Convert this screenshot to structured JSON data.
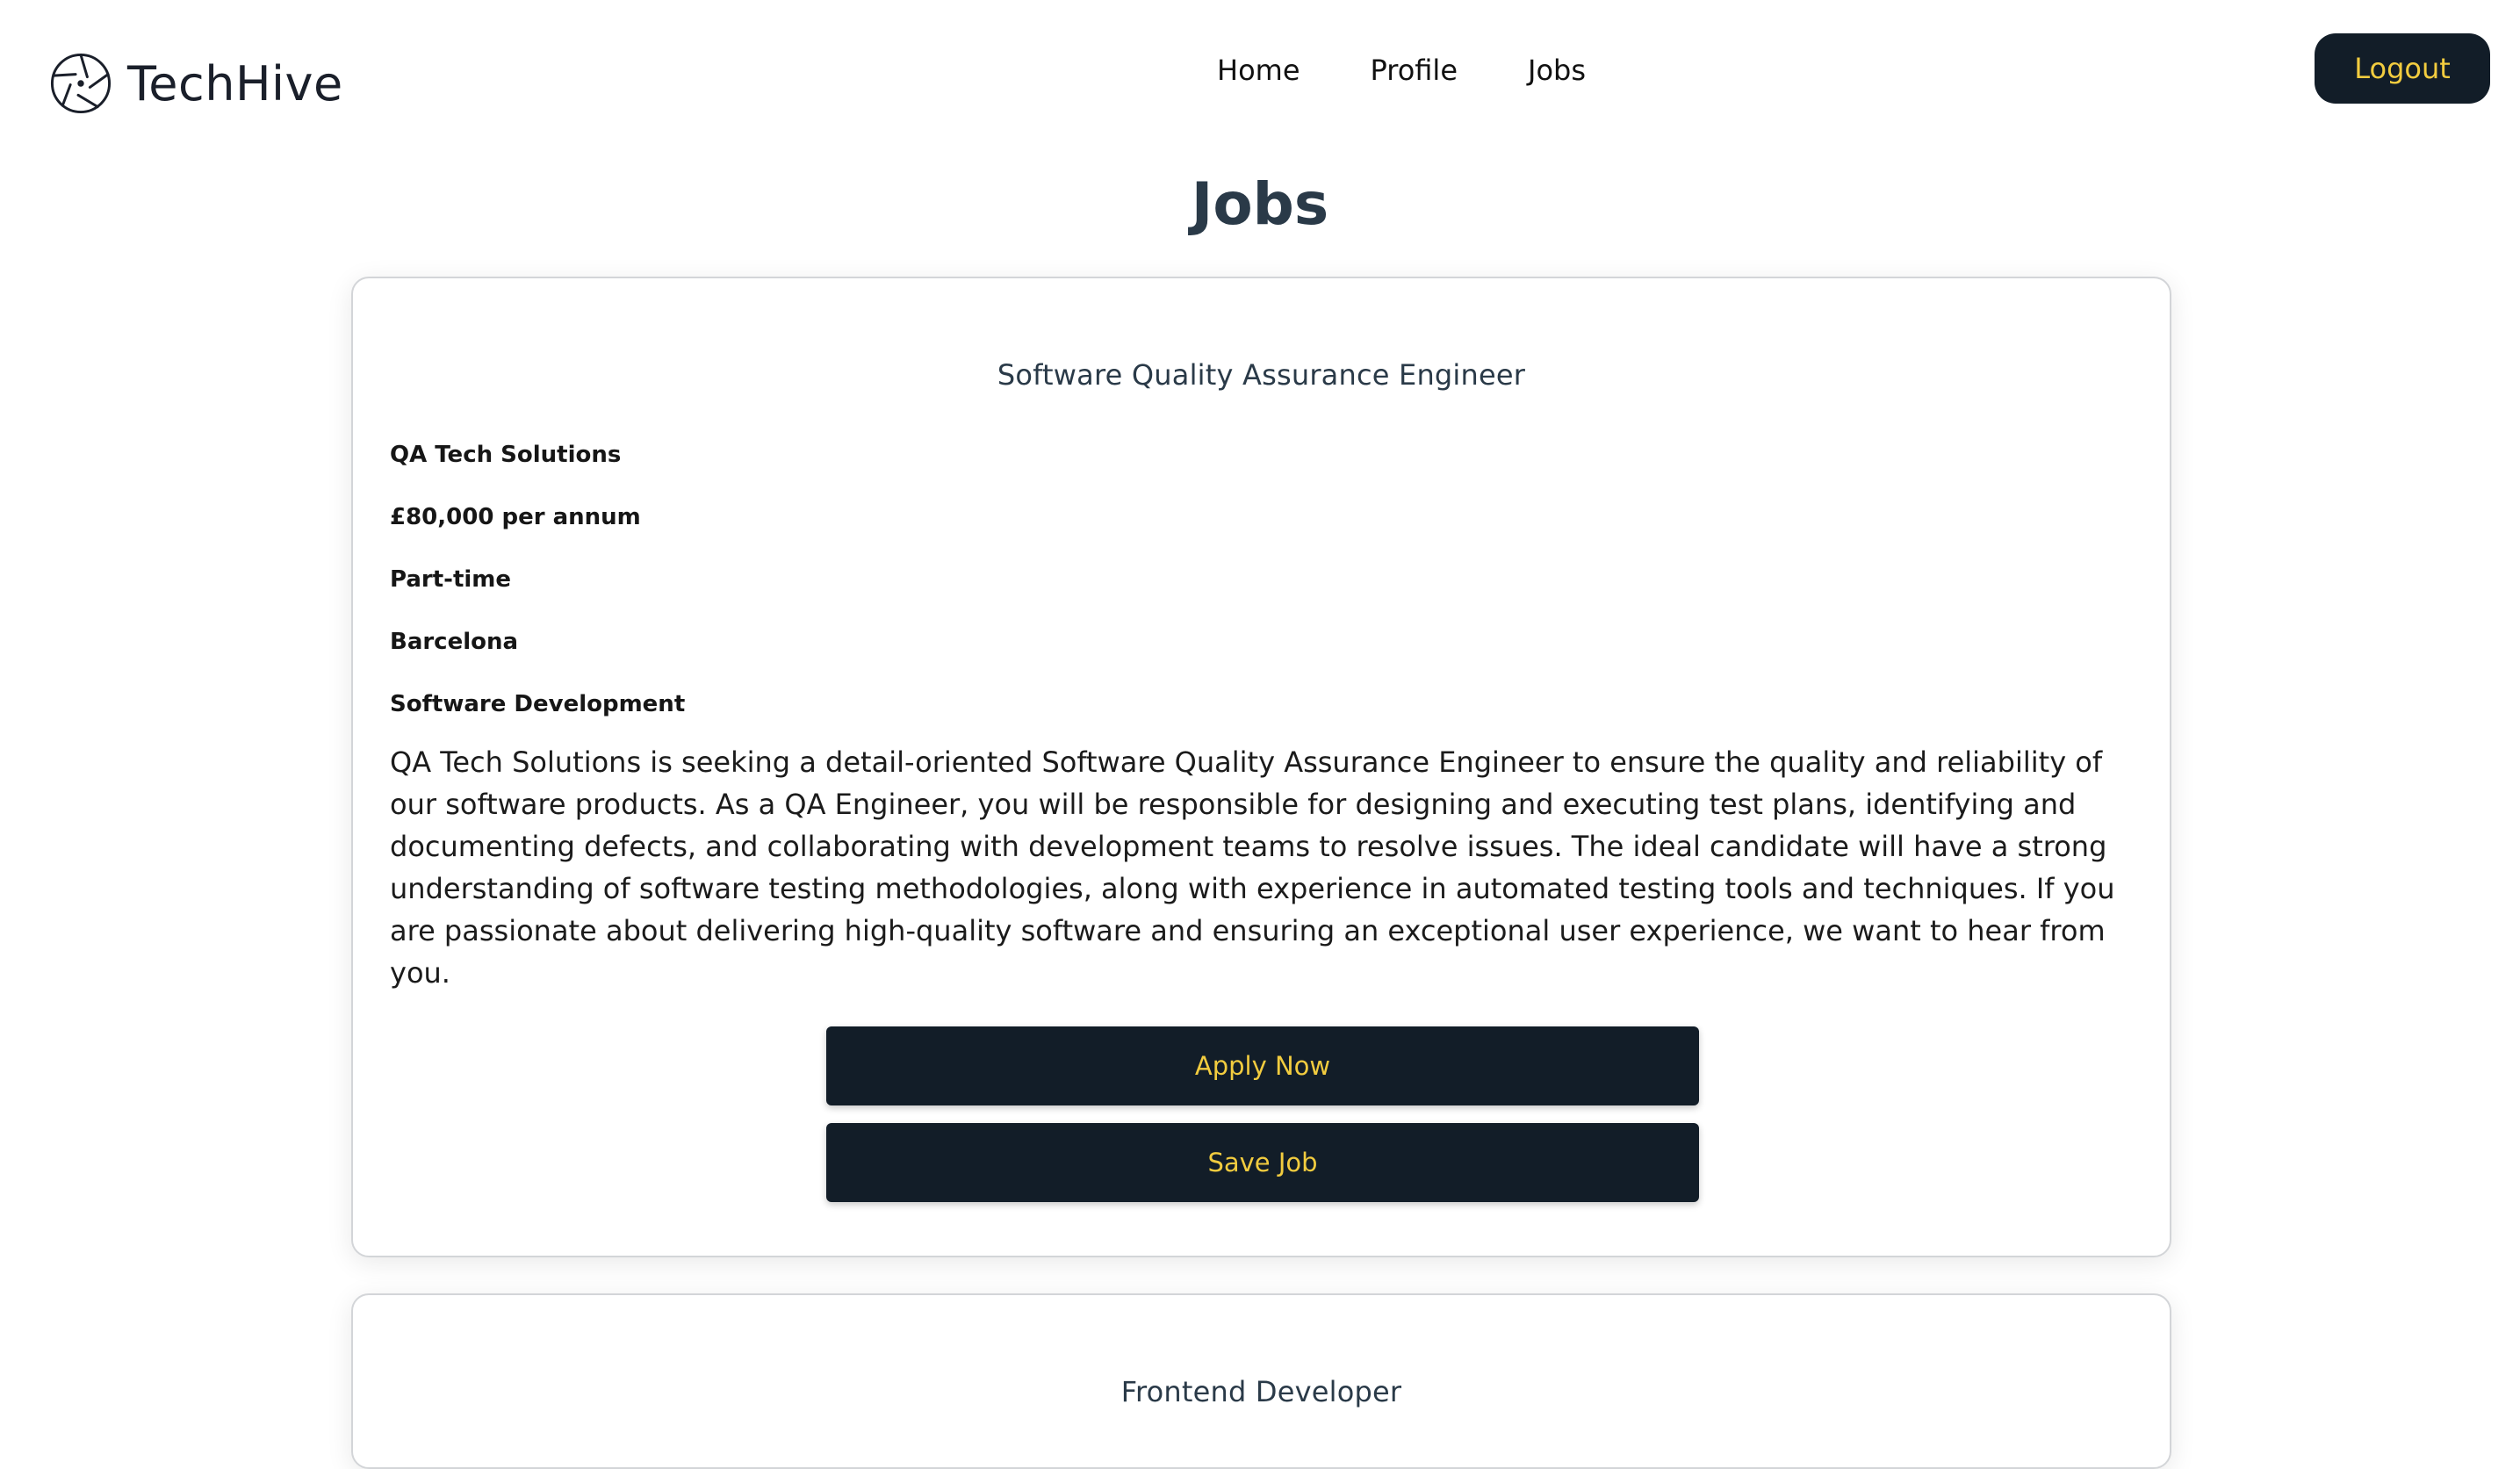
{
  "header": {
    "brand": "TechHive",
    "brand_icon": "aperture-icon",
    "nav": [
      "Home",
      "Profile",
      "Jobs"
    ],
    "logout_label": "Logout"
  },
  "colors": {
    "primary_dark": "#121d28",
    "accent_yellow": "#f2cc3f",
    "title_slate": "#2a3a48"
  },
  "page": {
    "title": "Jobs"
  },
  "jobs": [
    {
      "title": "Software Quality Assurance Engineer",
      "company": "QA Tech Solutions",
      "salary": "£80,000 per annum",
      "type": "Part-time",
      "location": "Barcelona",
      "category": "Software Development",
      "description": "QA Tech Solutions is seeking a detail-oriented Software Quality Assurance Engineer to ensure the quality and reliability of our software products. As a QA Engineer, you will be responsible for designing and executing test plans, identifying and documenting defects, and collaborating with development teams to resolve issues. The ideal candidate will have a strong understanding of software testing methodologies, along with experience in automated testing tools and techniques. If you are passionate about delivering high-quality software and ensuring an exceptional user experience, we want to hear from you.",
      "apply_label": "Apply Now",
      "save_label": "Save Job"
    },
    {
      "title": "Frontend Developer"
    }
  ]
}
